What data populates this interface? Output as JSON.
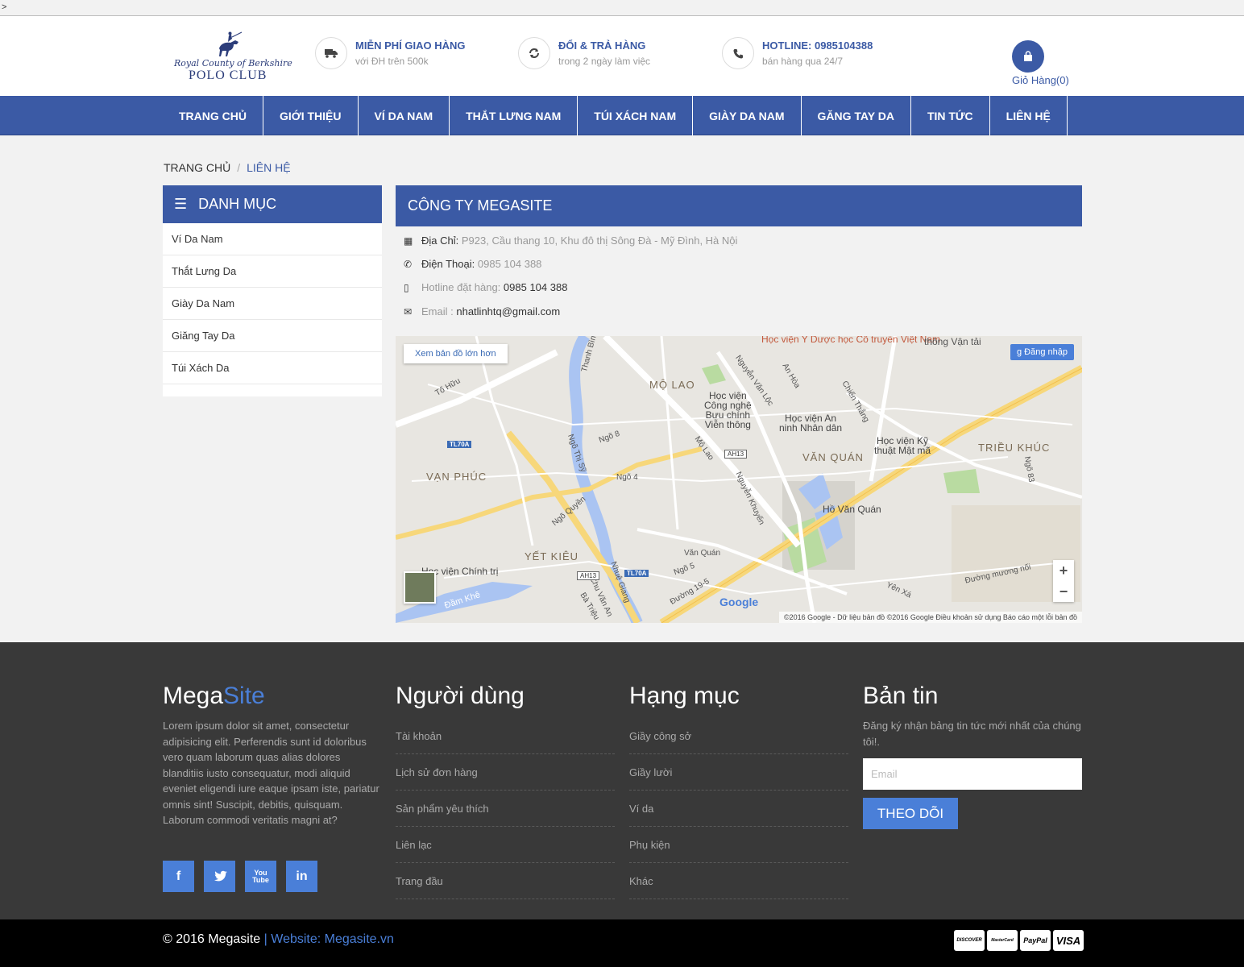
{
  "topline": {
    "mark": ">"
  },
  "header": {
    "logo": {
      "script_text": "Royal County of Berkshire",
      "brand_text": "POLO CLUB"
    },
    "features": [
      {
        "title": "MIỄN PHÍ GIAO HÀNG",
        "subtitle": "với ĐH trên 500k",
        "icon": "truck-icon"
      },
      {
        "title": "ĐỔI & TRẢ HÀNG",
        "subtitle": "trong 2 ngày làm việc",
        "icon": "refresh-icon"
      },
      {
        "title": "HOTLINE: 0985104388",
        "subtitle": "bán hàng qua 24/7",
        "icon": "phone-icon"
      }
    ],
    "cart": {
      "label": "Giỏ Hàng(0)"
    }
  },
  "nav": {
    "items": [
      "TRANG CHỦ",
      "GIỚI THIỆU",
      "VÍ DA NAM",
      "THẮT LƯNG NAM",
      "TÚI XÁCH NAM",
      "GIÀY DA NAM",
      "GĂNG TAY DA",
      "TIN TỨC",
      "LIÊN HỆ"
    ]
  },
  "breadcrumb": {
    "home": "TRANG CHỦ",
    "separator": "/",
    "current": "LIÊN HỆ"
  },
  "sidebar": {
    "title": "DANH MỤC",
    "items": [
      "Ví Da Nam",
      "Thắt Lưng Da",
      "Giày Da Nam",
      "Giăng Tay Da",
      "Túi Xách Da"
    ]
  },
  "contact": {
    "title": "CÔNG TY MEGASITE",
    "address_label": "Địa Chỉ:",
    "address_value": "P923, Cầu thang 10, Khu đô thị Sông Đà - Mỹ Đình, Hà Nội",
    "phone_label": "Điện Thoại:",
    "phone_value": "0985 104 388",
    "hotline_label": "Hotline đặt hàng:",
    "hotline_value": "0985 104 388",
    "email_label": "Email :",
    "email_value": "nhatlinhtq@gmail.com"
  },
  "map": {
    "larger_map": "Xem bản đồ lớn hơn",
    "sign_in": "Đăng nhập",
    "labels": {
      "l1": "Học viện Y Dược học\nCổ truyền Việt Nam",
      "l2": "thông Vận tải",
      "l3": "Học viện\nCông nghệ\nBưu chính\nViễn thông",
      "l4": "Học viện An\nninh Nhân dân",
      "l5": "Học viện Kỹ\nthuật Mật mã",
      "l6": "Hồ Văn Quán",
      "l7": "Học viện Chính trị",
      "l8": "Tố Hữu",
      "l9": "Thanh Bình",
      "l10": "Ngõ 8",
      "l11": "Ngõ 4",
      "l12": "Ngõ Quyền",
      "l13": "Văn Quán",
      "l14": "Ngõ 5",
      "l15": "Đường 19-5",
      "l16": "Đường mương nối",
      "l17": "Yên Xá",
      "l18": "Đầm Khê",
      "l19": "Ngõ 83",
      "l20": "Ngõ Thị Sỹ",
      "l21": "Nguyễn Văn Lộc",
      "l22": "Chiến Thắng",
      "l23": "An Hòa",
      "l24": "Mộ Lao",
      "l25": "Nguyễn Khuyến",
      "l26": "Chu Văn An",
      "l27": "Nhuệ Giang",
      "l28": "Bà Triệu"
    },
    "districts": {
      "d1": "MỘ LAO",
      "d2": "VẠN PHÚC",
      "d3": "YẾT KIÊU",
      "d4": "VĂN QUÁN",
      "d5": "TRIỀU KHÚC"
    },
    "road_tags": {
      "r1": "TL70A",
      "r2": "AH13",
      "r3": "AH13",
      "r4": "TL70A"
    },
    "google": "Google",
    "credits": "©2016 Google - Dữ liệu bản đồ ©2016 Google    Điều khoản sử dụng    Báo cáo một lỗi bản đồ"
  },
  "footer": {
    "about": {
      "title_main": "Mega",
      "title_accent": "Site",
      "text": "Lorem ipsum dolor sit amet, consectetur adipisicing elit. Perferendis sunt id doloribus vero quam laborum quas alias dolores blanditiis iusto consequatur, modi aliquid eveniet eligendi iure eaque ipsam iste, pariatur omnis sint! Suscipit, debitis, quisquam. Laborum commodi veritatis magni at?"
    },
    "social": [
      "f",
      "t",
      "You Tube",
      "in"
    ],
    "users": {
      "title": "Người dùng",
      "links": [
        "Tài khoản",
        "Lịch sử đơn hàng",
        "Sản phẩm yêu thích",
        "Liên lạc",
        "Trang đầu"
      ]
    },
    "categories": {
      "title": "Hạng mục",
      "links": [
        "Giầy công sở",
        "Giầy lười",
        "Ví da",
        "Phụ kiện",
        "Khác"
      ]
    },
    "newsletter": {
      "title": "Bản tin",
      "text": "Đăng ký nhận bảng tin tức mới nhất của chúng tôi!.",
      "placeholder": "Email",
      "button": "THEO DÕI"
    }
  },
  "bottom": {
    "copyright": "© 2016 Megasite",
    "website": " | Website: Megasite.vn",
    "payments": [
      "DISCOVER",
      "MasterCard",
      "PayPal",
      "VISA"
    ]
  }
}
